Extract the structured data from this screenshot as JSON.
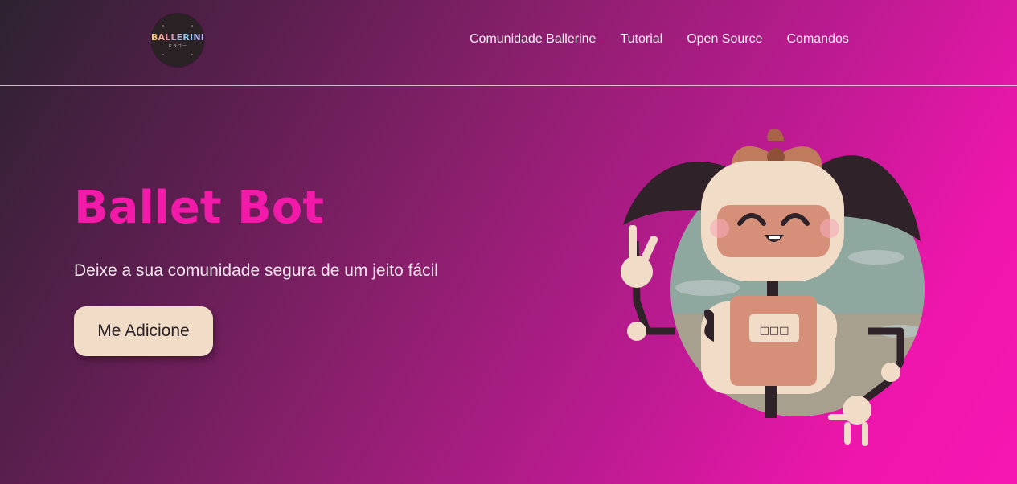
{
  "nav": {
    "logo": {
      "text": "BALLERINI",
      "subtext": "ドラゴー"
    },
    "links": [
      "Comunidade Ballerine",
      "Tutorial",
      "Open Source",
      "Comandos"
    ]
  },
  "hero": {
    "title": "Ballet Bot",
    "subtitle": "Deixe a sua comunidade segura de um jeito fácil",
    "cta": "Me Adicione",
    "chest_text": "□□□"
  },
  "colors": {
    "title": "#f21aa8",
    "button_bg": "#f1dcc8",
    "gradient_start": "#2c2230",
    "gradient_end": "#f716b2"
  },
  "icons": {
    "mascot": "robot-ballerina-illustration"
  }
}
